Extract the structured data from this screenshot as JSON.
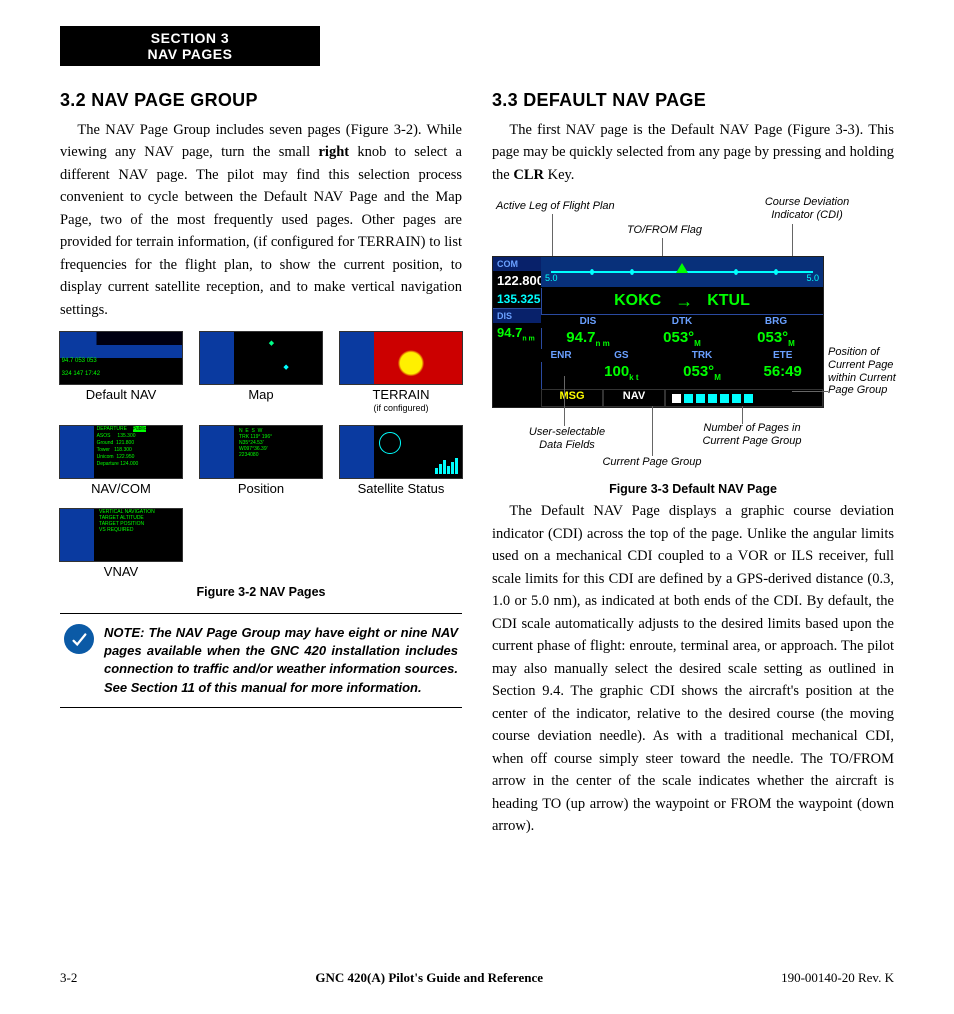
{
  "section_tab": {
    "line1": "SECTION 3",
    "line2": "NAV PAGES"
  },
  "left": {
    "heading": "3.2  NAV PAGE GROUP",
    "para1_a": "The NAV Page Group includes seven pages (Figure 3-2).  While viewing any NAV page, turn the small ",
    "para1_bold": "right",
    "para1_b": " knob to select a different NAV page.  The pilot may find this selection process convenient to cycle between the Default NAV Page and the Map Page, two of the most frequently used pages.  Other pages are provided for terrain information, (if configured for TERRAIN) to list frequencies for the flight plan, to show the current position, to display current satellite reception, and to make vertical navigation settings.",
    "thumbs": [
      {
        "label": "Default NAV",
        "sub": ""
      },
      {
        "label": "Map",
        "sub": ""
      },
      {
        "label": "TERRAIN",
        "sub": "(if configured)"
      },
      {
        "label": "NAV/COM",
        "sub": ""
      },
      {
        "label": "Position",
        "sub": ""
      },
      {
        "label": "Satellite Status",
        "sub": ""
      },
      {
        "label": "VNAV",
        "sub": ""
      }
    ],
    "fig_caption": "Figure 3-2  NAV Pages",
    "note": "NOTE:  The NAV Page Group may have eight or nine NAV pages available when the GNC 420 installation includes connection to traffic and/or weather information sources.  See Section 11 of this manual for more information."
  },
  "right": {
    "heading": "3.3  DEFAULT NAV PAGE",
    "para1_a": "The first NAV page is the Default NAV Page (Figure 3-3).  This page may be quickly selected from any page by pressing and holding the ",
    "para1_bold": "CLR",
    "para1_b": " Key.",
    "annot": {
      "active_leg": "Active Leg of Flight Plan",
      "cdi": "Course Deviation Indicator (CDI)",
      "toflag": "TO/FROM Flag",
      "userfields": "User-selectable Data Fields",
      "pagegroup": "Current Page Group",
      "numpages": "Number of Pages in Current Page Group",
      "pagepos": "Position of Current Page within Current Page Group"
    },
    "device": {
      "com_lbl": "COM",
      "com_active": "122.800",
      "com_standby": "135.325",
      "dis_lbl": "DIS",
      "dis_val": "94.7",
      "dis_unit": "n m",
      "cdi_left": "5.0",
      "cdi_right": "5.0",
      "wp_from": "KOKC",
      "wp_to": "KTUL",
      "hdr": [
        "DIS",
        "DTK",
        "BRG"
      ],
      "row1": [
        "94.7",
        "053°",
        "053°"
      ],
      "row1_units": [
        "n m",
        "M",
        "M"
      ],
      "hdr2": [
        "ENR",
        "GS",
        "TRK",
        "ETE"
      ],
      "row2": [
        "100",
        "053°",
        "56:49"
      ],
      "row2_units": [
        "k t",
        "M",
        ""
      ],
      "msg": "MSG",
      "nav": "NAV"
    },
    "fig_caption": "Figure 3-3  Default NAV Page",
    "para2": "The Default NAV Page displays a graphic course deviation indicator (CDI) across the top of the page. Unlike the angular limits used on a mechanical CDI coupled to a VOR or ILS receiver, full scale limits for this CDI are defined by a GPS-derived distance (0.3, 1.0 or 5.0 nm), as indicated at both ends of the CDI.  By default, the CDI scale automatically adjusts to the desired limits based upon the current phase of flight: enroute, terminal area, or approach.  The pilot may also manually select the desired scale setting as outlined in Section 9.4.  The graphic CDI shows the aircraft's position at the center of the indicator, relative to the desired course (the moving course deviation needle).  As with a traditional mechanical CDI, when  off course simply steer toward the needle.  The TO/FROM arrow in the center of the scale indicates whether the aircraft is heading TO (up arrow) the waypoint or FROM the waypoint (down arrow)."
  },
  "footer": {
    "left": "3-2",
    "center": "GNC 420(A) Pilot's Guide and Reference",
    "right": "190-00140-20  Rev. K"
  }
}
